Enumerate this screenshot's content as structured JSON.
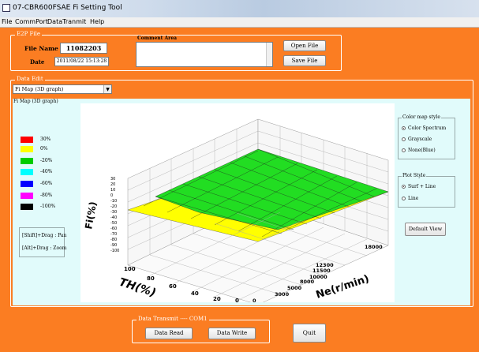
{
  "window": {
    "title": "07-CBR600FSAE Fi Setting Tool"
  },
  "menu": [
    "File",
    "CommPort",
    "DataTranmit",
    "Help"
  ],
  "e2p": {
    "group_label": "E2P File",
    "file_name_label": "File Name",
    "file_name": "11082203",
    "date_label": "Date",
    "date": "2011/08/22 15:13:28",
    "comment_label": "Comment Area",
    "comment": "",
    "open_btn": "Open File",
    "save_btn": "Save File"
  },
  "data_edit": {
    "group_label": "Data Edit",
    "selected": "Fi Map (3D graph)",
    "panel_label": "Fi Map (3D graph)"
  },
  "legend": [
    {
      "color": "#ff0000",
      "label": "30%"
    },
    {
      "color": "#ffff00",
      "label": "0%"
    },
    {
      "color": "#00cc00",
      "label": "-20%"
    },
    {
      "color": "#00ffff",
      "label": "-40%"
    },
    {
      "color": "#0000ff",
      "label": "-60%"
    },
    {
      "color": "#ff00ff",
      "label": "-80%"
    },
    {
      "color": "#000000",
      "label": "-100%"
    }
  ],
  "help": {
    "pan": "[Shift]+Drag : Pan",
    "zoom": "[Alt]+Drag : Zoom"
  },
  "color_map_style": {
    "label": "Color map style",
    "options": [
      "Color Spectrum",
      "Grayscale",
      "None(Blue)"
    ],
    "selected": 0
  },
  "plot_style": {
    "label": "Plot Style",
    "options": [
      "Surf + Line",
      "Line"
    ],
    "selected": 0
  },
  "default_view": "Default View",
  "graph": {
    "zlabel": "Fi(%)",
    "xlabel": "TH(%)",
    "ylabel": "Ne(r/min)",
    "th_ticks": [
      "100",
      "80",
      "60",
      "40",
      "20",
      "0"
    ],
    "ne_ticks": [
      "0",
      "3000",
      "5000",
      "8000",
      "10000",
      "11500",
      "12300",
      "18000"
    ],
    "z_ticks": [
      "30",
      "20",
      "10",
      "0",
      "-10",
      "-20",
      "-30",
      "-40",
      "-50",
      "-60",
      "-70",
      "-80",
      "-90",
      "-100"
    ]
  },
  "transmit": {
    "group_label": "Data Transmit ---- COM1",
    "read_btn": "Data Read",
    "write_btn": "Data Write",
    "quit_btn": "Quit"
  }
}
